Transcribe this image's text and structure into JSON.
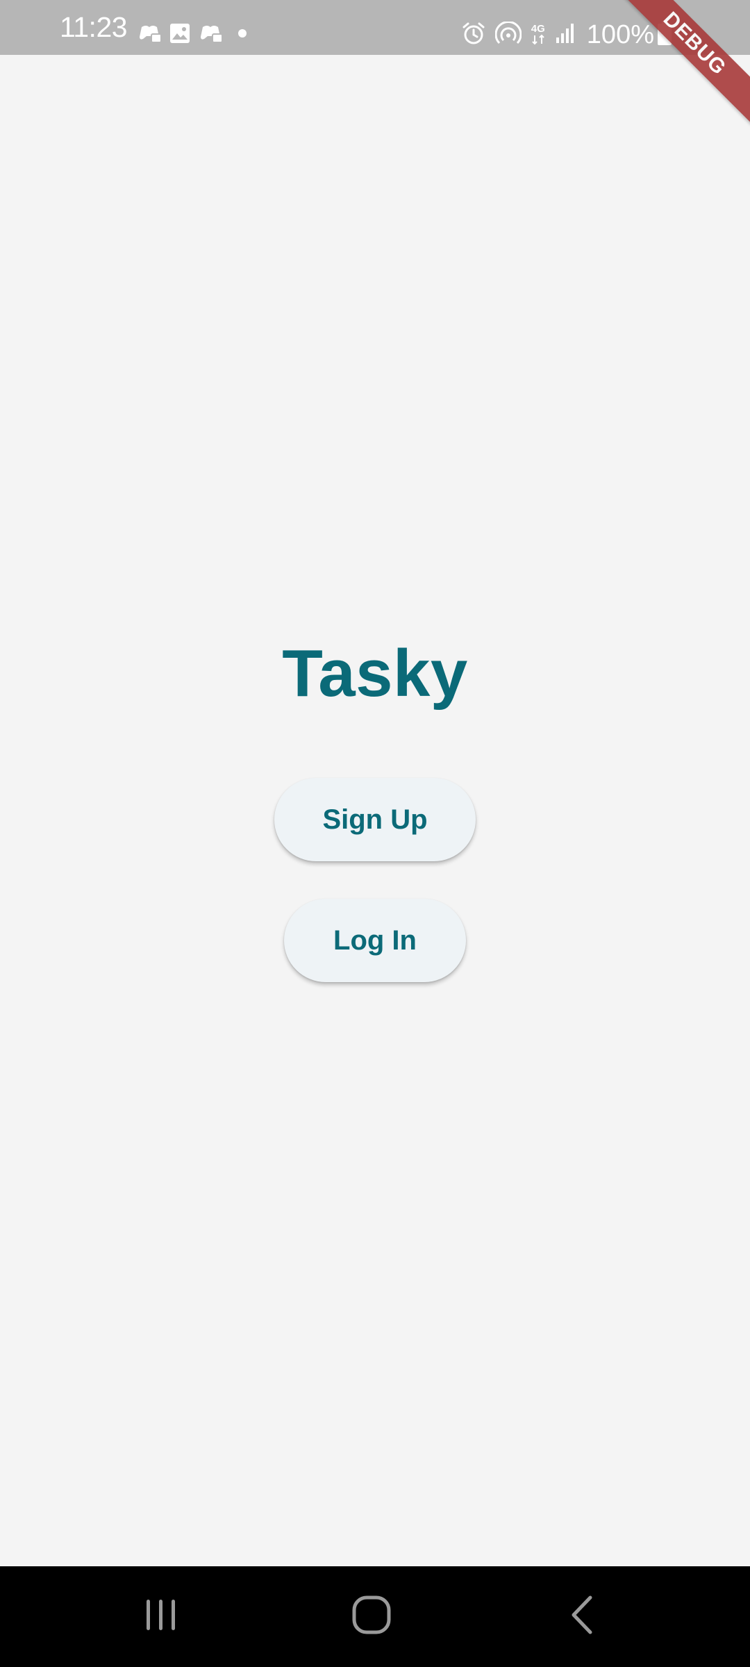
{
  "status_bar": {
    "time": "11:23",
    "left_icons": [
      "game-controller-icon",
      "image-icon",
      "game-controller-icon",
      "dot-icon"
    ],
    "right_icons": [
      "alarm-icon",
      "hotspot-icon",
      "network-4g-icon",
      "signal-icon"
    ],
    "network_label": "4G",
    "battery_text": "100%",
    "battery_icon": "battery-full-icon",
    "background": "#b6b6b6"
  },
  "debug_banner": {
    "label": "DEBUG",
    "color": "#a83a3a"
  },
  "app": {
    "title": "Tasky",
    "title_color": "#0b6a78",
    "background": "#f4f4f4"
  },
  "buttons": {
    "signup_label": "Sign Up",
    "login_label": "Log In",
    "background": "#eef3f6"
  },
  "nav_bar": {
    "recent_icon": "recent-apps-icon",
    "home_icon": "home-icon",
    "back_icon": "back-icon",
    "background": "#000000"
  }
}
